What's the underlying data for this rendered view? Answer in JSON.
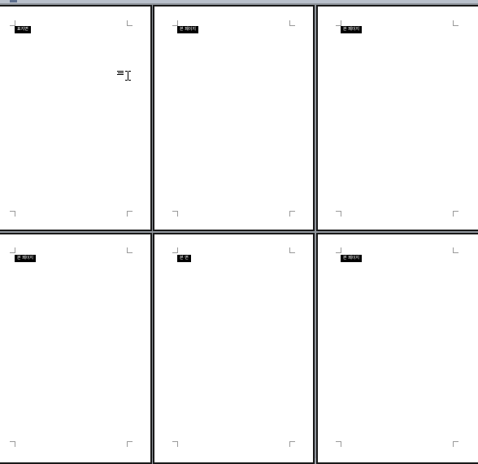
{
  "pages": [
    {
      "label": "표지면",
      "name": "page-1"
    },
    {
      "label": "본 페이지",
      "name": "page-2"
    },
    {
      "label": "본 페이지",
      "name": "page-3"
    },
    {
      "label": "본 페이지",
      "name": "page-4"
    },
    {
      "label": "본 면",
      "name": "page-5"
    },
    {
      "label": "본 페이지",
      "name": "page-6"
    }
  ],
  "cursor": {
    "icon": "text-cursor-icon"
  },
  "colors": {
    "workspace": "#8f959c",
    "page": "#ffffff",
    "label_bg": "#000000"
  }
}
